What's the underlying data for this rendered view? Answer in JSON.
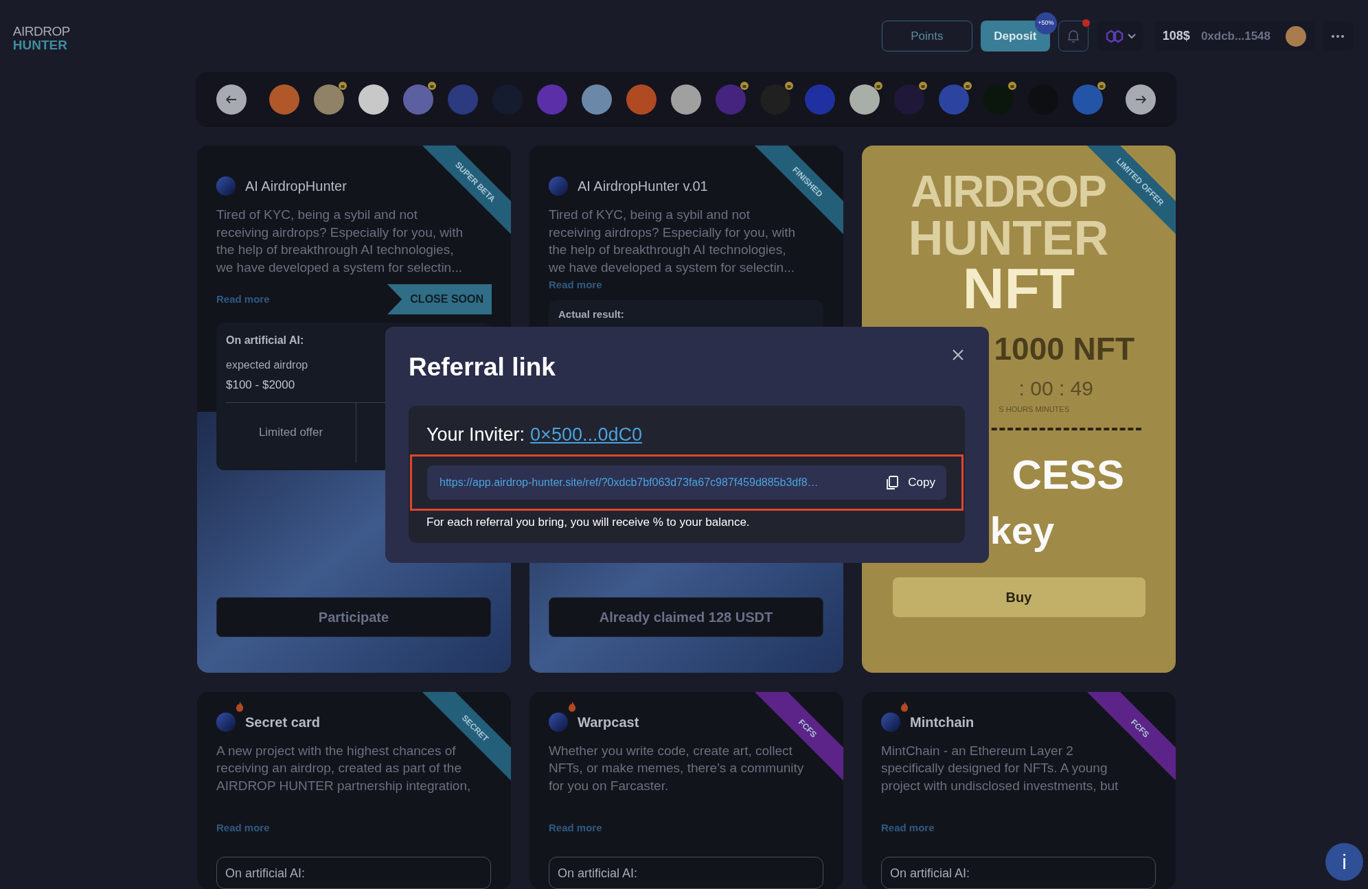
{
  "header": {
    "logo": [
      "AIRDROP",
      "HUNTER"
    ],
    "points": "Points",
    "deposit": {
      "label": "Deposit",
      "badge": "+50%"
    },
    "notification": {
      "unread": true
    },
    "balance": "108$",
    "wallet": "0xdcb...1548"
  },
  "coins": [
    {
      "color": "#b0582a",
      "badge": false
    },
    {
      "color": "#8f8266",
      "badge": true
    },
    {
      "color": "#c8c8c8",
      "badge": false
    },
    {
      "color": "#5c5fa0",
      "badge": true
    },
    {
      "color": "#2c3a80",
      "badge": false
    },
    {
      "color": "#161c30",
      "badge": false
    },
    {
      "color": "#5a2fa8",
      "badge": false
    },
    {
      "color": "#6c88a8",
      "badge": false
    },
    {
      "color": "#b04a22",
      "badge": false
    },
    {
      "color": "#a0a0a0",
      "badge": false
    },
    {
      "color": "#44247e",
      "badge": true
    },
    {
      "color": "#202020",
      "badge": true
    },
    {
      "color": "#2030a0",
      "badge": false
    },
    {
      "color": "#a8aea8",
      "badge": true
    },
    {
      "color": "#201838",
      "badge": true
    },
    {
      "color": "#2c44a0",
      "badge": true
    },
    {
      "color": "#0b170d",
      "badge": true
    },
    {
      "color": "#0d0f12",
      "badge": false
    },
    {
      "color": "#2354a8",
      "badge": true
    }
  ],
  "cards": [
    {
      "kind": "project",
      "title": "AI AirdropHunter",
      "ribbon": {
        "label": "SUPER BETA",
        "color": "#245f7a"
      },
      "description": "Tired of KYC, being a sybil and not receiving airdrops? Especially for you, with the help of breakthrough AI technologies, we have developed a system for selectin...",
      "read_more": "Read more",
      "tag": "CLOSE SOON",
      "stats": {
        "heading": "On artificial AI:",
        "label": "expected airdrop",
        "value": "$100 - $2000",
        "offer": "Limited offer"
      },
      "button": "Participate"
    },
    {
      "kind": "project",
      "title": "AI AirdropHunter v.01",
      "ribbon": {
        "label": "FINISHED",
        "color": "#245f7a"
      },
      "description": "Tired of KYC, being a sybil and not receiving airdrops? Especially for you, with the help of breakthrough AI technologies, we have developed a system for selectin...",
      "read_more": "Read more",
      "stats": {
        "heading": "Actual result:"
      },
      "button": "Already claimed 128 USDT"
    },
    {
      "kind": "nft",
      "ribbon": {
        "label": "LIMITED OFFER",
        "color": "#245f7a"
      },
      "brand": [
        "AIRDROP",
        "HUNTER"
      ],
      "big": "NFT",
      "supply": "1000 NFT",
      "timer": ": 00 : 49",
      "timer_units": "S HOURS MINUTES",
      "access": "CESS",
      "key": "key",
      "button": "Buy"
    },
    {
      "kind": "project",
      "hot": true,
      "title": "Secret card",
      "ribbon": {
        "label": "SECRET",
        "color": "#245f7a"
      },
      "description": "A new project with the highest chances of receiving an airdrop, created as part of the AIRDROP HUNTER partnership integration,",
      "read_more": "Read more",
      "stats": {
        "heading": "On artificial AI:"
      }
    },
    {
      "kind": "project",
      "hot": true,
      "title": "Warpcast",
      "ribbon": {
        "label": "FCFS",
        "color": "#5c2488"
      },
      "description": "Whether you write code, create art, collect NFTs, or make memes, there’s a community for you on Farcaster.",
      "read_more": "Read more",
      "stats": {
        "heading": "On artificial AI:"
      }
    },
    {
      "kind": "project",
      "hot": true,
      "title": "Mintchain",
      "ribbon": {
        "label": "FCFS",
        "color": "#5c2488"
      },
      "description": "MintChain - an Ethereum Layer 2 specifically designed for NFTs. A young project with undisclosed investments, but",
      "read_more": "Read more",
      "stats": {
        "heading": "On artificial AI:"
      }
    }
  ],
  "modal": {
    "title": "Referral link",
    "inviter_label": "Your Inviter:",
    "inviter": "0×500...0dC0",
    "link": "https://app.airdrop-hunter.site/ref/?0xdcb7bf063d73fa67c987f459d885b3df8…",
    "copy": "Copy",
    "note": "For each referral you bring, you will receive % to your balance.",
    "highlighted": true
  },
  "info": "i"
}
